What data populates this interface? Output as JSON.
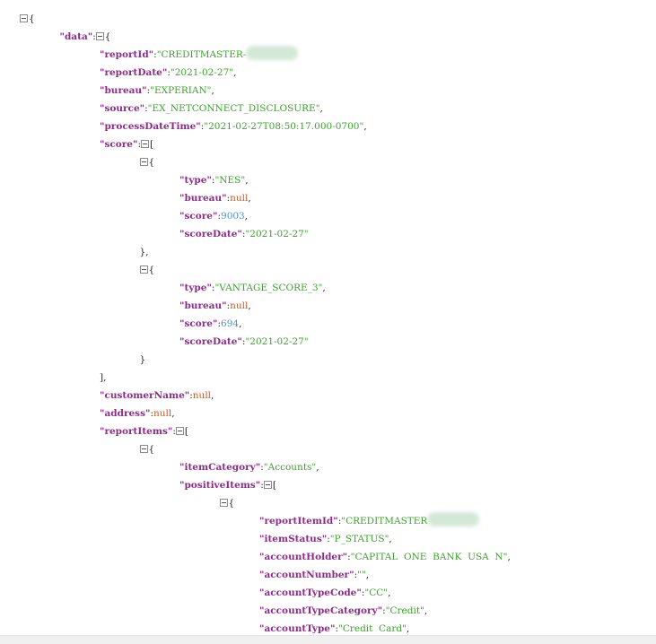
{
  "tree": [
    {
      "i": 0,
      "parts": [
        {
          "tog": true
        },
        {
          "c": "p",
          "t": "{"
        }
      ]
    },
    {
      "i": 1,
      "parts": [
        {
          "c": "key",
          "t": "\"data\""
        },
        {
          "c": "p",
          "t": ":"
        },
        {
          "tog": true
        },
        {
          "c": "p",
          "t": "{"
        }
      ]
    },
    {
      "i": 2,
      "parts": [
        {
          "c": "key",
          "t": "\"reportId\""
        },
        {
          "c": "p",
          "t": ":"
        },
        {
          "c": "str",
          "t": "\"CREDITMASTER-"
        },
        {
          "blur": true
        }
      ]
    },
    {
      "i": 2,
      "parts": [
        {
          "c": "key",
          "t": "\"reportDate\""
        },
        {
          "c": "p",
          "t": ":"
        },
        {
          "c": "str",
          "t": "\"2021-02-27\""
        },
        {
          "c": "p",
          "t": ","
        }
      ]
    },
    {
      "i": 2,
      "parts": [
        {
          "c": "key",
          "t": "\"bureau\""
        },
        {
          "c": "p",
          "t": ":"
        },
        {
          "c": "str",
          "t": "\"EXPERIAN\""
        },
        {
          "c": "p",
          "t": ","
        }
      ]
    },
    {
      "i": 2,
      "parts": [
        {
          "c": "key",
          "t": "\"source\""
        },
        {
          "c": "p",
          "t": ":"
        },
        {
          "c": "str",
          "t": "\"EX_NETCONNECT_DISCLOSURE\""
        },
        {
          "c": "p",
          "t": ","
        }
      ]
    },
    {
      "i": 2,
      "parts": [
        {
          "c": "key",
          "t": "\"processDateTime\""
        },
        {
          "c": "p",
          "t": ":"
        },
        {
          "c": "str",
          "t": "\"2021-02-27T08:50:17.000-0700\""
        },
        {
          "c": "p",
          "t": ","
        }
      ]
    },
    {
      "i": 2,
      "parts": [
        {
          "c": "key",
          "t": "\"score\""
        },
        {
          "c": "p",
          "t": ":"
        },
        {
          "tog": true
        },
        {
          "c": "p",
          "t": "["
        }
      ]
    },
    {
      "i": 3,
      "parts": [
        {
          "tog": true
        },
        {
          "c": "p",
          "t": "{"
        }
      ]
    },
    {
      "i": 4,
      "parts": [
        {
          "c": "key",
          "t": "\"type\""
        },
        {
          "c": "p",
          "t": ":"
        },
        {
          "c": "str",
          "t": "\"NES\""
        },
        {
          "c": "p",
          "t": ","
        }
      ]
    },
    {
      "i": 4,
      "parts": [
        {
          "c": "key",
          "t": "\"bureau\""
        },
        {
          "c": "p",
          "t": ":"
        },
        {
          "c": "nul",
          "t": "null"
        },
        {
          "c": "p",
          "t": ","
        }
      ]
    },
    {
      "i": 4,
      "parts": [
        {
          "c": "key",
          "t": "\"score\""
        },
        {
          "c": "p",
          "t": ":"
        },
        {
          "c": "num",
          "t": "9003"
        },
        {
          "c": "p",
          "t": ","
        }
      ]
    },
    {
      "i": 4,
      "parts": [
        {
          "c": "key",
          "t": "\"scoreDate\""
        },
        {
          "c": "p",
          "t": ":"
        },
        {
          "c": "str",
          "t": "\"2021-02-27\""
        }
      ]
    },
    {
      "i": 3,
      "parts": [
        {
          "c": "p",
          "t": "},"
        }
      ]
    },
    {
      "i": 3,
      "parts": [
        {
          "tog": true
        },
        {
          "c": "p",
          "t": "{"
        }
      ]
    },
    {
      "i": 4,
      "parts": [
        {
          "c": "key",
          "t": "\"type\""
        },
        {
          "c": "p",
          "t": ":"
        },
        {
          "c": "str",
          "t": "\"VANTAGE_SCORE_3\""
        },
        {
          "c": "p",
          "t": ","
        }
      ]
    },
    {
      "i": 4,
      "parts": [
        {
          "c": "key",
          "t": "\"bureau\""
        },
        {
          "c": "p",
          "t": ":"
        },
        {
          "c": "nul",
          "t": "null"
        },
        {
          "c": "p",
          "t": ","
        }
      ]
    },
    {
      "i": 4,
      "parts": [
        {
          "c": "key",
          "t": "\"score\""
        },
        {
          "c": "p",
          "t": ":"
        },
        {
          "c": "num",
          "t": "694"
        },
        {
          "c": "p",
          "t": ","
        }
      ]
    },
    {
      "i": 4,
      "parts": [
        {
          "c": "key",
          "t": "\"scoreDate\""
        },
        {
          "c": "p",
          "t": ":"
        },
        {
          "c": "str",
          "t": "\"2021-02-27\""
        }
      ]
    },
    {
      "i": 3,
      "parts": [
        {
          "c": "p",
          "t": "}"
        }
      ]
    },
    {
      "i": 2,
      "parts": [
        {
          "c": "p",
          "t": "],"
        }
      ]
    },
    {
      "i": 2,
      "parts": [
        {
          "c": "key",
          "t": "\"customerName\""
        },
        {
          "c": "p",
          "t": ":"
        },
        {
          "c": "nul",
          "t": "null"
        },
        {
          "c": "p",
          "t": ","
        }
      ]
    },
    {
      "i": 2,
      "parts": [
        {
          "c": "key",
          "t": "\"address\""
        },
        {
          "c": "p",
          "t": ":"
        },
        {
          "c": "nul",
          "t": "null"
        },
        {
          "c": "p",
          "t": ","
        }
      ]
    },
    {
      "i": 2,
      "parts": [
        {
          "c": "key",
          "t": "\"reportItems\""
        },
        {
          "c": "p",
          "t": ":"
        },
        {
          "tog": true
        },
        {
          "c": "p",
          "t": "["
        }
      ]
    },
    {
      "i": 3,
      "parts": [
        {
          "tog": true
        },
        {
          "c": "p",
          "t": "{"
        }
      ]
    },
    {
      "i": 4,
      "parts": [
        {
          "c": "key",
          "t": "\"itemCategory\""
        },
        {
          "c": "p",
          "t": ":"
        },
        {
          "c": "str",
          "t": "\"Accounts\""
        },
        {
          "c": "p",
          "t": ","
        }
      ]
    },
    {
      "i": 4,
      "parts": [
        {
          "c": "key",
          "t": "\"positiveItems\""
        },
        {
          "c": "p",
          "t": ":"
        },
        {
          "tog": true
        },
        {
          "c": "p",
          "t": "["
        }
      ]
    },
    {
      "i": 5,
      "parts": [
        {
          "tog": true
        },
        {
          "c": "p",
          "t": "{"
        }
      ]
    },
    {
      "i": 6,
      "parts": [
        {
          "c": "key",
          "t": "\"reportItemId\""
        },
        {
          "c": "p",
          "t": ":"
        },
        {
          "c": "str",
          "t": "\"CREDITMASTER"
        },
        {
          "blur": true
        }
      ]
    },
    {
      "i": 6,
      "parts": [
        {
          "c": "key",
          "t": "\"itemStatus\""
        },
        {
          "c": "p",
          "t": ":"
        },
        {
          "c": "str",
          "t": "\"P_STATUS\""
        },
        {
          "c": "p",
          "t": ","
        }
      ]
    },
    {
      "i": 6,
      "parts": [
        {
          "c": "key",
          "t": "\"accountHolder\""
        },
        {
          "c": "p",
          "t": ":"
        },
        {
          "c": "str",
          "t": "\"CAPITAL  ONE  BANK  USA  N\""
        },
        {
          "c": "p",
          "t": ","
        }
      ]
    },
    {
      "i": 6,
      "parts": [
        {
          "c": "key",
          "t": "\"accountNumber\""
        },
        {
          "c": "p",
          "t": ":"
        },
        {
          "c": "str",
          "t": "\"\""
        },
        {
          "c": "p",
          "t": ","
        }
      ]
    },
    {
      "i": 6,
      "parts": [
        {
          "c": "key",
          "t": "\"accountTypeCode\""
        },
        {
          "c": "p",
          "t": ":"
        },
        {
          "c": "str",
          "t": "\"CC\""
        },
        {
          "c": "p",
          "t": ","
        }
      ]
    },
    {
      "i": 6,
      "parts": [
        {
          "c": "key",
          "t": "\"accountTypeCategory\""
        },
        {
          "c": "p",
          "t": ":"
        },
        {
          "c": "str",
          "t": "\"Credit\""
        },
        {
          "c": "p",
          "t": ","
        }
      ]
    },
    {
      "i": 6,
      "parts": [
        {
          "c": "key",
          "t": "\"accountType\""
        },
        {
          "c": "p",
          "t": ":"
        },
        {
          "c": "str",
          "t": "\"Credit  Card\""
        },
        {
          "c": "p",
          "t": ","
        }
      ]
    }
  ]
}
